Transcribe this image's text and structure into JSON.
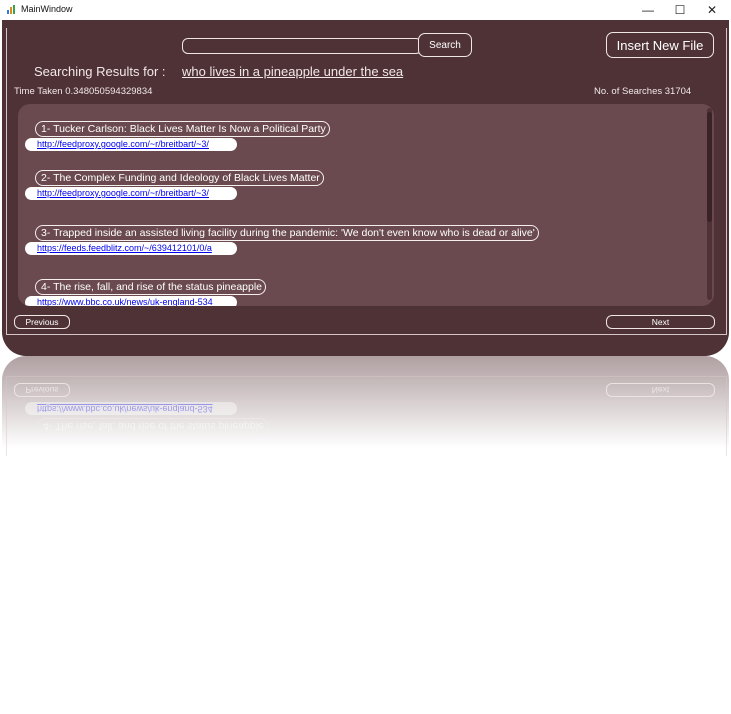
{
  "window": {
    "title": "MainWindow",
    "minimize_glyph": "—",
    "maximize_glyph": "☐",
    "close_glyph": "✕"
  },
  "toolbar": {
    "search_value": "",
    "search_button": "Search",
    "insert_button": "Insert New File"
  },
  "summary": {
    "results_label": "Searching Results for :",
    "query": "who lives in a pineapple under the sea",
    "time_taken": "Time Taken 0.348050594329834",
    "searches_count": "No. of Searches 31704"
  },
  "results": [
    {
      "title": "1- Tucker Carlson: Black Lives Matter Is Now a Political Party",
      "link": "http://feedproxy.google.com/~r/breitbart/~3/"
    },
    {
      "title": "2- The Complex Funding and Ideology of Black Lives Matter",
      "link": "http://feedproxy.google.com/~r/breitbart/~3/"
    },
    {
      "title": "3- Trapped inside an assisted living facility during the pandemic: 'We don't even know who is dead or alive'",
      "link": "https://feeds.feedblitz.com/~/639412101/0/a"
    },
    {
      "title": "4- The rise, fall, and rise of the status pineapple",
      "link": "https://www.bbc.co.uk/news/uk-england-534"
    }
  ],
  "pagination": {
    "previous": "Previous",
    "next": "Next"
  },
  "colors": {
    "panel": "#4e3236",
    "results_bg": "#6a4a4e",
    "link": "#0000ee"
  },
  "icons": [
    "app-icon",
    "minimize-icon",
    "maximize-icon",
    "close-icon"
  ]
}
